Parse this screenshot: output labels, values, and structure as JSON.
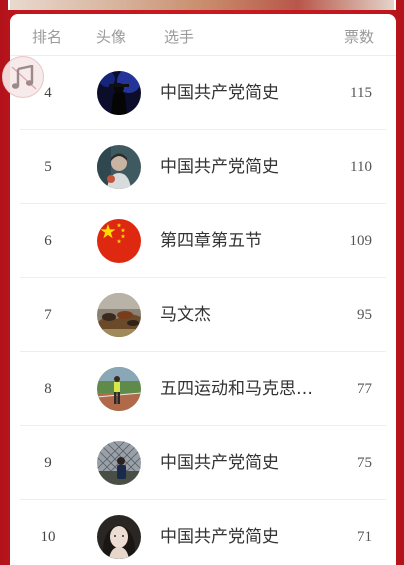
{
  "header": {
    "rank_label": "排名",
    "avatar_label": "头像",
    "player_label": "选手",
    "votes_label": "票数"
  },
  "music": {
    "icon": "music-note-icon"
  },
  "rows": [
    {
      "rank": "4",
      "name": "中国共产党简史",
      "votes": "115",
      "avatar": "dark-silhouette"
    },
    {
      "rank": "5",
      "name": "中国共产党简史",
      "votes": "110",
      "avatar": "person-portrait"
    },
    {
      "rank": "6",
      "name": "第四章第五节",
      "votes": "109",
      "avatar": "china-flag"
    },
    {
      "rank": "7",
      "name": "马文杰",
      "votes": "95",
      "avatar": "horses-painting"
    },
    {
      "rank": "8",
      "name": "五四运动和马克思主义的传播",
      "votes": "77",
      "avatar": "person-on-track"
    },
    {
      "rank": "9",
      "name": "中国共产党简史",
      "votes": "75",
      "avatar": "person-by-fence"
    },
    {
      "rank": "10",
      "name": "中国共产党简史",
      "votes": "71",
      "avatar": "girl-portrait"
    }
  ],
  "colors": {
    "background": "#c81a20",
    "card": "#ffffff",
    "header_text": "#9a9a9a"
  }
}
